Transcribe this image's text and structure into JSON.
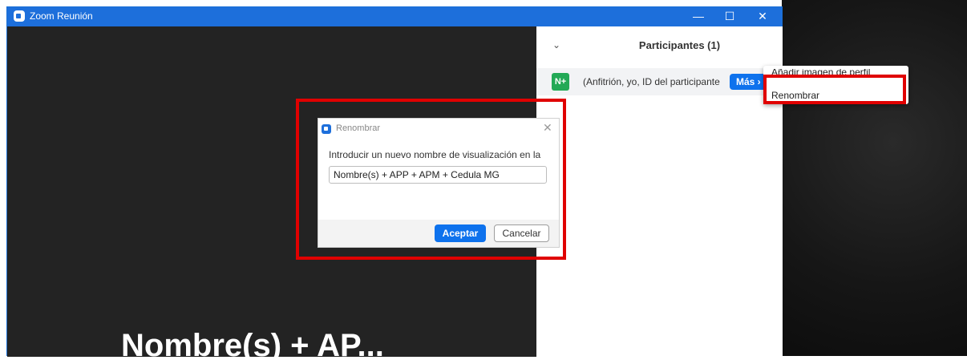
{
  "window": {
    "title": "Zoom Reunión",
    "minimize": "—",
    "maximize": "☐",
    "close": "✕"
  },
  "video": {
    "display_name": "Nombre(s) + AP..."
  },
  "participants": {
    "collapse": "⌄",
    "title": "Participantes (1)",
    "rows": [
      {
        "avatar": "N+",
        "label": "(Anfitrión, yo, ID del participante",
        "more_button": "Más ›"
      }
    ]
  },
  "context_menu": {
    "items": [
      "Añadir imagen de perfil",
      "Renombrar"
    ]
  },
  "rename_dialog": {
    "title": "Renombrar",
    "close": "✕",
    "prompt": "Introducir un nuevo nombre de visualización en la",
    "input_value": "Nombre(s) + APP + APM + Cedula MG",
    "accept": "Aceptar",
    "cancel": "Cancelar"
  },
  "colors": {
    "zoom_blue": "#0e72ed",
    "highlight_red": "#e00000",
    "avatar_green": "#23a956"
  }
}
